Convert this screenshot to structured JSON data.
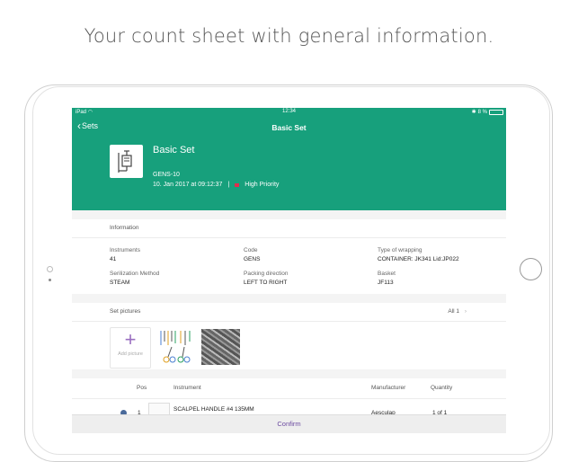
{
  "headline": "Your count sheet with general information.",
  "status_bar": {
    "carrier": "iPad",
    "time": "12:34",
    "battery": "8 %"
  },
  "nav": {
    "back_label": "Sets",
    "title": "Basic Set"
  },
  "set": {
    "name": "Basic Set",
    "code": "GENS-10",
    "date": "10. Jan 2017 at 09:12:37",
    "separator": "|",
    "priority": "High Priority",
    "priority_color": "#e02d4d"
  },
  "information": {
    "title": "Information",
    "fields": [
      {
        "label": "Instruments",
        "value": "41"
      },
      {
        "label": "Code",
        "value": "GENS"
      },
      {
        "label": "Type of wrapping",
        "value": "CONTAINER: JK341 Lid:JP022"
      },
      {
        "label": "Serilization Method",
        "value": "STEAM"
      },
      {
        "label": "Packing direction",
        "value": "LEFT TO RIGHT"
      },
      {
        "label": "Basket",
        "value": "JF113"
      }
    ]
  },
  "pictures": {
    "title": "Set pictures",
    "all_label": "All 1",
    "add_label": "Add picture"
  },
  "table": {
    "headers": {
      "pos": "Pos",
      "instrument": "Instrument",
      "manufacturer": "Manufacturer",
      "quantity": "Quantity"
    },
    "rows": [
      {
        "pos": "1",
        "instrument": "SCALPEL HANDLE #4 135MM",
        "manufacturer": "Aesculap",
        "quantity": "1 of 1"
      }
    ]
  },
  "confirm_label": "Confirm",
  "colors": {
    "accent": "#17a07c",
    "confirm": "#6b4aa0"
  }
}
